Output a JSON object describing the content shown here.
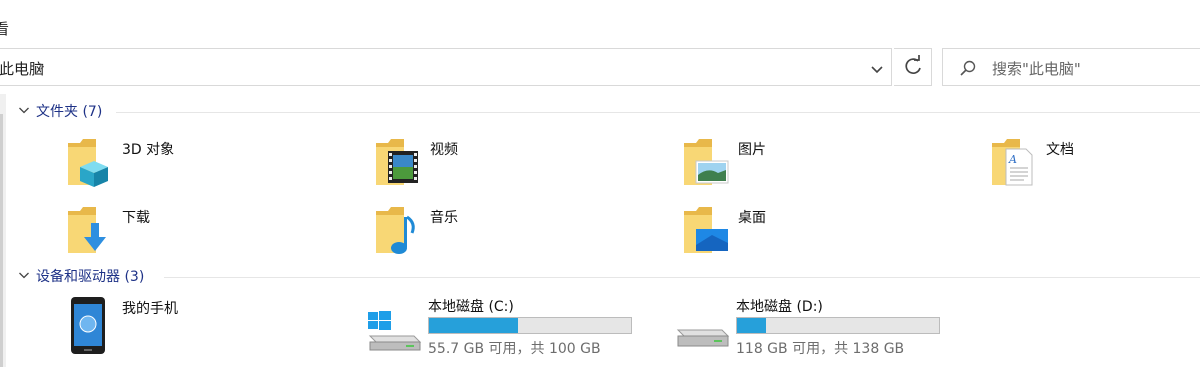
{
  "ribbon": {
    "tab_label": "看"
  },
  "address": {
    "path_text": "此电脑",
    "chevron": "›"
  },
  "search": {
    "placeholder": "搜索\"此电脑\""
  },
  "groups": {
    "folders": {
      "label": "文件夹 (7)",
      "items": [
        {
          "label": "3D 对象",
          "icon": "3d-objects-folder-icon"
        },
        {
          "label": "视频",
          "icon": "videos-folder-icon"
        },
        {
          "label": "图片",
          "icon": "pictures-folder-icon"
        },
        {
          "label": "文档",
          "icon": "documents-folder-icon"
        },
        {
          "label": "下载",
          "icon": "downloads-folder-icon"
        },
        {
          "label": "音乐",
          "icon": "music-folder-icon"
        },
        {
          "label": "桌面",
          "icon": "desktop-folder-icon"
        }
      ]
    },
    "devices": {
      "label": "设备和驱动器 (3)",
      "phone": {
        "label": "我的手机",
        "icon": "phone-icon"
      },
      "drives": [
        {
          "label": "本地磁盘 (C:)",
          "info": "55.7 GB 可用，共 100 GB",
          "used_fraction": 0.443,
          "icon": "windows-drive-icon"
        },
        {
          "label": "本地磁盘 (D:)",
          "info": "118 GB 可用，共 138 GB",
          "used_fraction": 0.145,
          "icon": "hard-drive-icon"
        }
      ]
    }
  },
  "colors": {
    "group_header": "#1e3287",
    "bar_fill": "#26a0da",
    "folder": "#f8d775"
  }
}
